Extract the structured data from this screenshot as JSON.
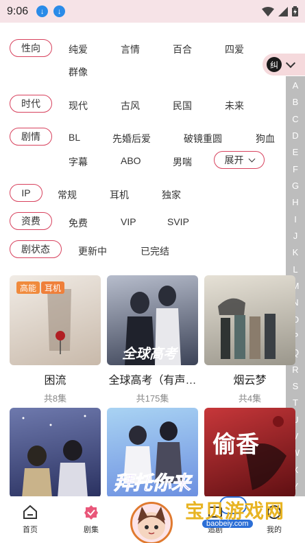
{
  "status_bar": {
    "time": "9:06"
  },
  "filters": {
    "orientation": {
      "label": "性向",
      "options": [
        "纯爱",
        "言情",
        "百合",
        "四爱",
        "群像"
      ]
    },
    "era": {
      "label": "时代",
      "options": [
        "现代",
        "古风",
        "民国",
        "未来"
      ]
    },
    "plot": {
      "label": "剧情",
      "options": [
        "BL",
        "先婚后爱",
        "破镜重圆",
        "狗血",
        "字幕",
        "ABO",
        "男喘"
      ],
      "expand_label": "展开"
    },
    "ip": {
      "label": "IP",
      "options": [
        "常规",
        "耳机",
        "独家"
      ]
    },
    "fee": {
      "label": "资费",
      "options": [
        "免费",
        "VIP",
        "SVIP"
      ]
    },
    "status": {
      "label": "剧状态",
      "options": [
        "更新中",
        "已完结"
      ]
    }
  },
  "switch_button": {
    "glyph": "纠"
  },
  "alphabet": [
    "A",
    "B",
    "C",
    "D",
    "E",
    "F",
    "G",
    "H",
    "I",
    "J",
    "K",
    "L",
    "M",
    "N",
    "O",
    "P",
    "Q",
    "R",
    "S",
    "T",
    "U",
    "V",
    "W",
    "X",
    "Y"
  ],
  "cards": [
    {
      "title": "困流",
      "count": "共8集",
      "tags": [
        "高能",
        "耳机"
      ],
      "colors": [
        "#e9e3dc",
        "#b9a99a"
      ]
    },
    {
      "title": "全球高考（有声…",
      "count": "共175集",
      "tags": [],
      "colors": [
        "#9aa3b5",
        "#4a5266"
      ]
    },
    {
      "title": "烟云梦",
      "count": "共4集",
      "tags": [],
      "colors": [
        "#d8d2c6",
        "#6b6a62"
      ]
    },
    {
      "title": "",
      "count": "",
      "tags": [],
      "colors": [
        "#5d6a9c",
        "#2d3560"
      ]
    },
    {
      "title": "",
      "count": "",
      "tags": [],
      "colors": [
        "#8ab8e6",
        "#5b4fcf"
      ]
    },
    {
      "title": "",
      "count": "",
      "tags": [],
      "colors": [
        "#c43a3a",
        "#5a1010"
      ]
    }
  ],
  "cover_texts": {
    "c2": "全球高考",
    "c5": "拜托你来",
    "c6": "偷香"
  },
  "tag_colors": {
    "高能": "#f08a3c",
    "耳机": "#ef7f3a"
  },
  "bottom_nav": {
    "home": "首页",
    "drama": "剧集",
    "mine": "我的",
    "fourth_partial": "追剧"
  },
  "watermark": {
    "text": "宝贝游戏网",
    "url": "baobeiy.com"
  },
  "accent_color": "#d7405c"
}
